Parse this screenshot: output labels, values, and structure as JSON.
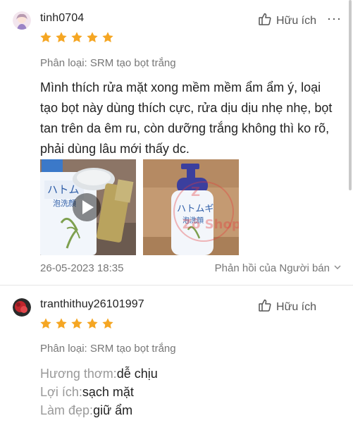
{
  "reviews": [
    {
      "username": "tinh0704",
      "rating": 5,
      "helpful_label": "Hữu ích",
      "more_label": "···",
      "variation": "Phân loại: SRM tạo bọt trắng",
      "text": "Mình thích rửa mặt xong mềm mềm ẩm ẩm ý, loại tạo bọt này dùng thích cực, rửa dịu dịu nhẹ nhẹ, bọt tan trên da êm ru, còn dưỡng trắng không thì ko rõ, phải dùng lâu mới thấy dc.",
      "media": [
        {
          "kind": "video",
          "label": "video-thumbnail"
        },
        {
          "kind": "image",
          "watermark": "Zô Shop"
        }
      ],
      "date": "26-05-2023 18:35",
      "seller_reply_label": "Phản hồi của Người bán"
    },
    {
      "username": "tranthithuy26101997",
      "rating": 5,
      "helpful_label": "Hữu ích",
      "more_label": "···",
      "variation": "Phân loại: SRM tạo bọt trắng",
      "attributes": [
        {
          "label": "Hương thơm:",
          "value": "dễ chịu"
        },
        {
          "label": "Lợi ích:",
          "value": "sạch mặt"
        },
        {
          "label": "Làm đẹp:",
          "value": "giữ ẩm"
        }
      ]
    }
  ],
  "colors": {
    "star": "#f5a623",
    "muted_text": "#777777",
    "label_text": "#999999",
    "divider": "#e6e6e6"
  }
}
